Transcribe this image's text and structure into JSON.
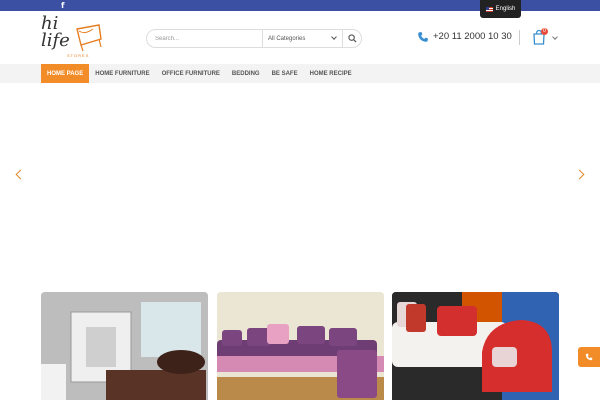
{
  "topbar": {
    "facebook_glyph": "f",
    "language": {
      "label": "English",
      "flag_icon": "us-flag-icon"
    }
  },
  "brand": {
    "logo_text": "hi life",
    "logo_subtext": "STORES",
    "logo_accent": "#e67e22"
  },
  "search": {
    "placeholder": "Search...",
    "category_selected": "All Categories"
  },
  "contact": {
    "phone": "+20 11 2000 10 30"
  },
  "cart": {
    "count": "0"
  },
  "nav": {
    "items": [
      {
        "label": "HOME PAGE",
        "active": true
      },
      {
        "label": "HOME FURNITURE",
        "active": false
      },
      {
        "label": "OFFICE FURNITURE",
        "active": false
      },
      {
        "label": "BEDDING",
        "active": false
      },
      {
        "label": "BE SAFE",
        "active": false
      },
      {
        "label": "HOME RECIPE",
        "active": false
      }
    ]
  },
  "colors": {
    "topbar": "#3b4fa3",
    "accent_orange": "#f28c28",
    "nav_bg": "#f3f3f3"
  },
  "cards": [
    {
      "icon": "bedroom-photo"
    },
    {
      "icon": "sofa-photo"
    },
    {
      "icon": "living-room-photo"
    }
  ]
}
